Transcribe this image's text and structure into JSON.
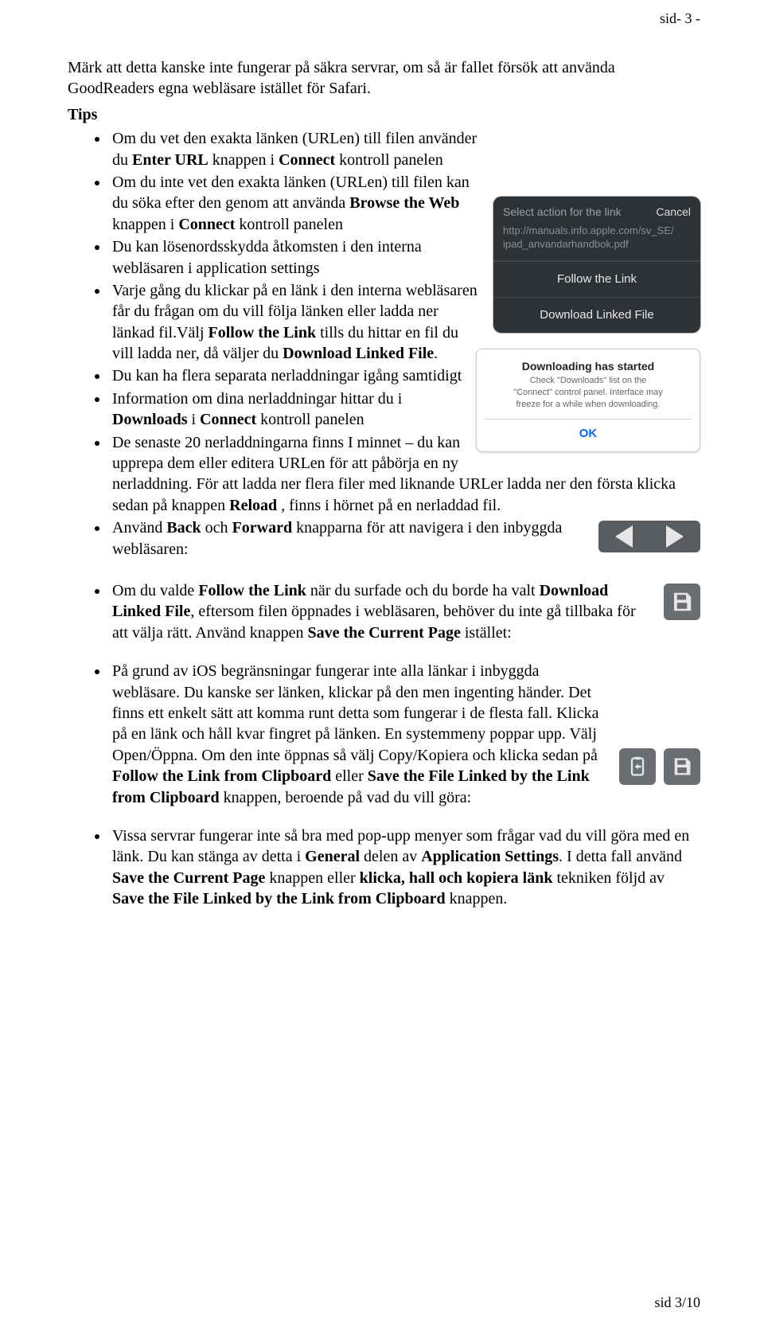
{
  "header": {
    "page_tag": "sid- 3 -"
  },
  "footer": {
    "page_tag": "sid 3/10"
  },
  "intro": {
    "p1a": "Märk att detta kanske inte fungerar på säkra servrar, om så är fallet försök att använda GoodReaders egna webläsare istället för Safari."
  },
  "tips_label": "Tips",
  "bul": {
    "b1": {
      "a": "Om du vet den exakta länken (URLen) till filen använder du ",
      "enter": "Enter URL",
      "b": " knappen i ",
      "connect": "Connect",
      "c": " kontroll panelen"
    },
    "b2": {
      "a": "Om du inte vet den exakta länken (URLen) till filen kan du söka efter den genom att använda ",
      "browse": "Browse the Web",
      "b": " knappen i ",
      "connect": "Connect",
      "c": " kontroll panelen"
    },
    "b3": {
      "a": "Du kan lösenordsskydda åtkomsten i den interna webläsaren i application settings"
    },
    "b4": {
      "a": "Varje gång du klickar på en länk i den interna webläsaren får du frågan om du vill följa länken eller ladda ner länkad fil.Välj ",
      "follow": "Follow the Link",
      "b": " tills du hittar en fil du vill ladda ner, då väljer du ",
      "dl": "Download Linked File",
      "c": "."
    },
    "b5": {
      "a": "Du kan ha flera separata nerladdningar igång samtidigt"
    },
    "b6": {
      "a": "Information om dina nerladdningar hittar du i ",
      "dls": "Downloads",
      "b": " i ",
      "connect": "Connect",
      "c": " kontroll panelen"
    },
    "b7": {
      "a": "De senaste 20 nerladdningarna finns I minnet – du kan upprepa dem eller editera URLen för att påbörja en ny nerladdning. För att ladda ner flera filer med liknande URLer ladda ner den första klicka sedan på knappen ",
      "reload": "Reload",
      "b": " , finns i hörnet på en nerladdad fil."
    },
    "b8": {
      "a": "Använd ",
      "back": "Back",
      "b": " och ",
      "fwd": "Forward",
      "c": " knapparna för att navigera i den inbyggda webläsaren:"
    },
    "b9": {
      "a": "Om du valde ",
      "follow": "Follow the Link",
      "b": " när du surfade och du borde ha valt ",
      "dl": "Download Linked File",
      "c": ", eftersom filen öppnades i webläsaren, behöver du inte gå tillbaka för att välja rätt. Använd knappen ",
      "save": "Save the Current Page",
      "d": " istället:"
    },
    "b10": {
      "a": "På grund av iOS begränsningar fungerar inte alla länkar i inbyggda webläsare. Du kanske ser länken, klickar på den men ingenting händer. Det finns ett enkelt sätt att komma runt detta som fungerar i de flesta fall. Klicka på en länk och håll kvar fingret på länken. En systemmeny poppar upp. Välj Open/Öppna. Om den inte öppnas så välj Copy/Kopiera och klicka sedan på ",
      "flc": "Follow the Link from Clipboard",
      "b": " eller ",
      "sflc": "Save the File Linked by the Link from Clipboard",
      "c": " knappen, beroende på vad du vill göra:"
    },
    "b11": {
      "a": "Vissa servrar fungerar inte så bra med pop-upp menyer som frågar vad du vill göra med en länk. Du kan stänga av detta i ",
      "gen": "General",
      "b": " delen av ",
      "appset": "Application Settings",
      "c": ". I detta fall använd ",
      "save": "Save the Current Page",
      "d": " knappen eller ",
      "khk": "klicka, hall och kopiera länk",
      "e": " tekniken följd av ",
      "sflc": "Save the File Linked by the Link from Clipboard",
      "f": " knappen."
    }
  },
  "dlg": {
    "select": "Select action for the link",
    "cancel": "Cancel",
    "url1": "http://manuals.info.apple.com/sv_SE/",
    "url2": "ipad_anvandarhandbok.pdf",
    "follow": "Follow the Link",
    "download": "Download Linked File"
  },
  "toast": {
    "title": "Downloading has started",
    "line1": "Check \"Downloads\" list on the",
    "line2": "\"Connect\" control panel. Interface may",
    "line3": "freeze for a while when downloading.",
    "ok": "OK"
  }
}
